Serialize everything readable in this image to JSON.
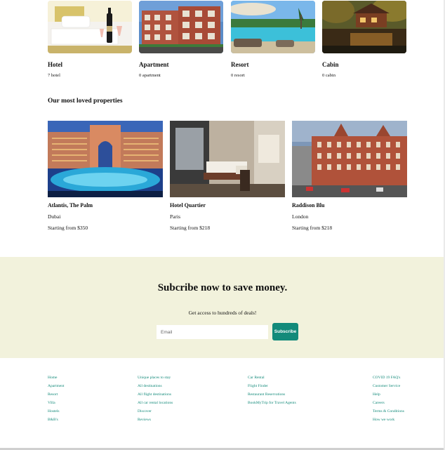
{
  "property_types": [
    {
      "name": "Hotel",
      "count": "7 hotel",
      "image": "hotel-room-photo"
    },
    {
      "name": "Apartment",
      "count": "0 apartment",
      "image": "apartment-building-photo"
    },
    {
      "name": "Resort",
      "count": "0 resort",
      "image": "resort-pool-photo"
    },
    {
      "name": "Cabin",
      "count": "0 cabin",
      "image": "lake-cabin-photo"
    }
  ],
  "loved": {
    "title": "Our most loved properties",
    "items": [
      {
        "name": "Atlantis, The Palm",
        "city": "Dubai",
        "price": "Starting from $350",
        "image": "atlantis-palm-photo"
      },
      {
        "name": "Hotel Quartier",
        "city": "Paris",
        "price": "Starting from $218",
        "image": "hotel-room-photo"
      },
      {
        "name": "Raddison Blu",
        "city": "London",
        "price": "Starting from $218",
        "image": "london-hotel-photo"
      }
    ]
  },
  "subscribe": {
    "title": "Subcribe now to save money.",
    "text": "Get access to hundreds of deals!",
    "placeholder": "Email",
    "button": "Subscribe",
    "background": "#f2f2dc",
    "accent": "#138a7a"
  },
  "footer": {
    "col1": [
      "Home",
      "Apartment",
      "Resort",
      "Villa",
      "Hostels",
      "B&B's"
    ],
    "col2": [
      "Unique places to stay",
      "All destinations",
      "All flight destinations",
      "All car rental locations",
      "Discover",
      "Reviews"
    ],
    "col3": [
      "Car Rental",
      "Flight Finder",
      "Restaurant Reservations",
      "BookMyTrip for Travel Agents"
    ],
    "col4": [
      "COVID 19 FAQ's",
      "Customer Service",
      "Help",
      "Careers",
      "Terms & Conditions",
      "How we work"
    ],
    "link_color": "#138a7a"
  }
}
